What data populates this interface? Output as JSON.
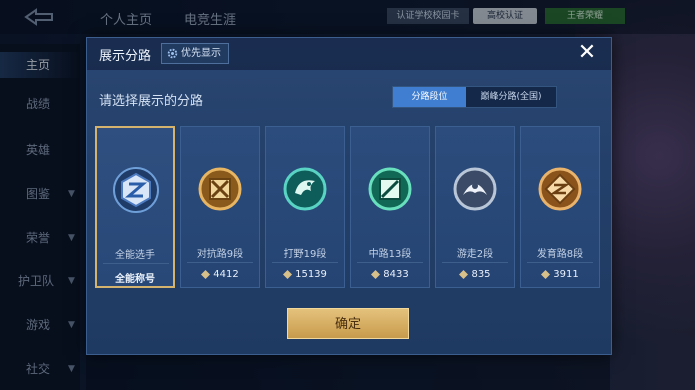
{
  "topbar": {
    "tabs": [
      "个人主页",
      "电竞生涯"
    ],
    "verify_label": "认证学校校园卡",
    "school_label": "高校认证",
    "badge_label": "王者荣耀"
  },
  "sidebar": {
    "items": [
      {
        "label": "主页",
        "active": true
      },
      {
        "label": "战绩"
      },
      {
        "label": "英雄"
      },
      {
        "label": "图鉴"
      },
      {
        "label": "荣誉"
      },
      {
        "label": "护卫队"
      },
      {
        "label": "游戏"
      },
      {
        "label": "社交"
      }
    ]
  },
  "dialog": {
    "title": "展示分路",
    "priority_label": "优先显示",
    "close_icon": "close-icon",
    "prompt": "请选择展示的分路",
    "tabs": [
      {
        "label": "分路段位",
        "active": true
      },
      {
        "label": "巅峰分路(全国)",
        "active": false
      }
    ],
    "cards": [
      {
        "name": "全能选手",
        "foot": "全能称号",
        "icon": "all-round-emblem-icon",
        "selected": true
      },
      {
        "name": "对抗路9段",
        "foot": "4412",
        "icon": "clash-lane-emblem-icon"
      },
      {
        "name": "打野19段",
        "foot": "15139",
        "icon": "jungle-emblem-icon"
      },
      {
        "name": "中路13段",
        "foot": "8433",
        "icon": "mid-lane-emblem-icon"
      },
      {
        "name": "游走2段",
        "foot": "835",
        "icon": "roam-emblem-icon"
      },
      {
        "name": "发育路8段",
        "foot": "3911",
        "icon": "farm-lane-emblem-icon"
      }
    ],
    "confirm_label": "确定"
  },
  "colors": {
    "accent_blue": "#3f7ed0",
    "gold": "#d4b36e",
    "dialog_bg": "#23406a"
  }
}
